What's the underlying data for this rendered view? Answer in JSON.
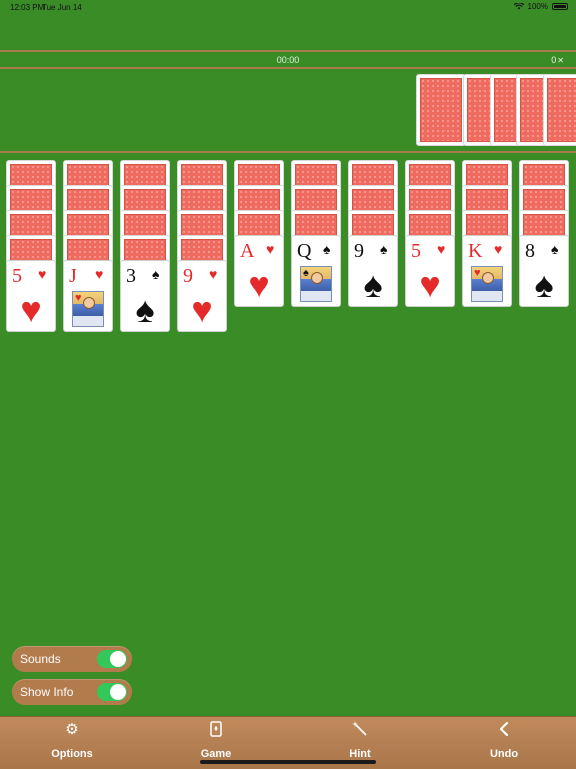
{
  "status_bar": {
    "time": "12:03 PM",
    "date": "Tue Jun 14",
    "battery": "100%"
  },
  "game_info": {
    "timer": "00:00",
    "score": "0"
  },
  "tableau": [
    {
      "hidden": 4,
      "top": {
        "rank": "5",
        "suit": "♥",
        "color": "red",
        "face": false
      }
    },
    {
      "hidden": 4,
      "top": {
        "rank": "J",
        "suit": "♥",
        "color": "red",
        "face": true
      }
    },
    {
      "hidden": 4,
      "top": {
        "rank": "3",
        "suit": "♠",
        "color": "black",
        "face": false
      }
    },
    {
      "hidden": 4,
      "top": {
        "rank": "9",
        "suit": "♥",
        "color": "red",
        "face": false
      }
    },
    {
      "hidden": 3,
      "top": {
        "rank": "A",
        "suit": "♥",
        "color": "red",
        "face": false
      }
    },
    {
      "hidden": 3,
      "top": {
        "rank": "Q",
        "suit": "♠",
        "color": "black",
        "face": true
      }
    },
    {
      "hidden": 3,
      "top": {
        "rank": "9",
        "suit": "♠",
        "color": "black",
        "face": false
      }
    },
    {
      "hidden": 3,
      "top": {
        "rank": "5",
        "suit": "♥",
        "color": "red",
        "face": false
      }
    },
    {
      "hidden": 3,
      "top": {
        "rank": "K",
        "suit": "♥",
        "color": "red",
        "face": true
      }
    },
    {
      "hidden": 3,
      "top": {
        "rank": "8",
        "suit": "♠",
        "color": "black",
        "face": false
      }
    }
  ],
  "stock_piles": 5,
  "toggles": [
    {
      "label": "Sounds",
      "on": true
    },
    {
      "label": "Show Info",
      "on": true
    }
  ],
  "toolbar": [
    {
      "label": "Options",
      "icon": "gears-icon"
    },
    {
      "label": "Game",
      "icon": "card-icon"
    },
    {
      "label": "Hint",
      "icon": "magic-wand-icon"
    },
    {
      "label": "Undo",
      "icon": "chevron-left-icon"
    }
  ],
  "colors": {
    "felt": "#3a8c27",
    "card_back": "#ef6b5f",
    "wood": "#b27b4c",
    "switch_on": "#34c759"
  }
}
